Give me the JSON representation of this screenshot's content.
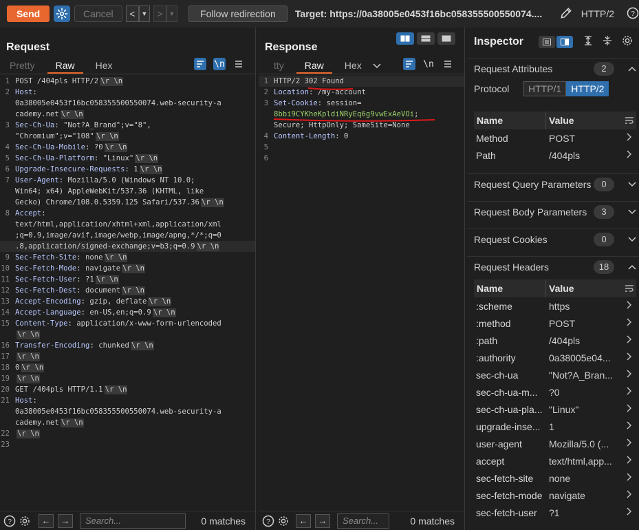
{
  "toolbar": {
    "send_label": "Send",
    "cancel_label": "Cancel",
    "back_glyph": "<",
    "forward_glyph": ">",
    "dropdown_glyph": "▼",
    "follow_label": "Follow redirection",
    "target": "Target: https://0a38005e0453f16bc058355500550074....",
    "protocol": "HTTP/2",
    "accent_color": "#e8672e",
    "settings_icon": "gear-icon",
    "edit_icon": "pencil-icon",
    "help_icon": "help-icon"
  },
  "request": {
    "title": "Request",
    "tabs": [
      "Pretty",
      "Raw",
      "Hex"
    ],
    "active_tab": "Raw",
    "icon_ln": "\\n",
    "lines": [
      {
        "n": "1",
        "parts": [
          {
            "t": "POST /404pls HTTP/2"
          }
        ],
        "eol": "\\r \\n"
      },
      {
        "n": "2",
        "parts": [
          {
            "t": "Host",
            "k": 1
          },
          {
            "t": ":"
          }
        ]
      },
      {
        "n": "",
        "parts": [
          {
            "t": "0a38005e0453f16bc058355500550074.web-security-a"
          }
        ]
      },
      {
        "n": "",
        "parts": [
          {
            "t": "cademy.net"
          }
        ],
        "eol": "\\r \\n"
      },
      {
        "n": "3",
        "parts": [
          {
            "t": "Sec-Ch-Ua",
            "k": 1
          },
          {
            "t": ": \"Not?A_Brand\";v=\"8\","
          }
        ]
      },
      {
        "n": "",
        "parts": [
          {
            "t": "\"Chromium\";v=\"108\""
          }
        ],
        "eol": "\\r \\n"
      },
      {
        "n": "4",
        "parts": [
          {
            "t": "Sec-Ch-Ua-Mobile",
            "k": 1
          },
          {
            "t": ": ?0"
          }
        ],
        "eol": "\\r \\n"
      },
      {
        "n": "5",
        "parts": [
          {
            "t": "Sec-Ch-Ua-Platform",
            "k": 1
          },
          {
            "t": ": \"Linux\""
          }
        ],
        "eol": "\\r \\n"
      },
      {
        "n": "6",
        "parts": [
          {
            "t": "Upgrade-Insecure-Requests",
            "k": 1
          },
          {
            "t": ": 1"
          }
        ],
        "eol": "\\r \\n"
      },
      {
        "n": "7",
        "parts": [
          {
            "t": "User-Agent",
            "k": 1
          },
          {
            "t": ": Mozilla/5.0 (Windows NT 10.0;"
          }
        ]
      },
      {
        "n": "",
        "parts": [
          {
            "t": "Win64; x64) AppleWebKit/537.36 (KHTML, like"
          }
        ]
      },
      {
        "n": "",
        "parts": [
          {
            "t": "Gecko) Chrome/108.0.5359.125 Safari/537.36"
          }
        ],
        "eol": "\\r \\n"
      },
      {
        "n": "8",
        "parts": [
          {
            "t": "Accept",
            "k": 1
          },
          {
            "t": ":"
          }
        ]
      },
      {
        "n": "",
        "parts": [
          {
            "t": "text/html,application/xhtml+xml,application/xml"
          }
        ]
      },
      {
        "n": "",
        "parts": [
          {
            "t": ";q=0.9,image/avif,image/webp,image/apng,*/*;q=0"
          }
        ]
      },
      {
        "n": "",
        "parts": [
          {
            "t": ".8,application/signed-exchange;v=b3;q=0.9"
          }
        ],
        "eol": "\\r \\n",
        "hl": 1
      },
      {
        "n": "9",
        "parts": [
          {
            "t": "Sec-Fetch-Site",
            "k": 1
          },
          {
            "t": ": none"
          }
        ],
        "eol": "\\r \\n"
      },
      {
        "n": "10",
        "parts": [
          {
            "t": "Sec-Fetch-Mode",
            "k": 1
          },
          {
            "t": ": navigate"
          }
        ],
        "eol": "\\r \\n"
      },
      {
        "n": "11",
        "parts": [
          {
            "t": "Sec-Fetch-User",
            "k": 1
          },
          {
            "t": ": ?1"
          }
        ],
        "eol": "\\r \\n"
      },
      {
        "n": "12",
        "parts": [
          {
            "t": "Sec-Fetch-Dest",
            "k": 1
          },
          {
            "t": ": document"
          }
        ],
        "eol": "\\r \\n"
      },
      {
        "n": "13",
        "parts": [
          {
            "t": "Accept-Encoding",
            "k": 1
          },
          {
            "t": ": gzip, deflate"
          }
        ],
        "eol": "\\r \\n"
      },
      {
        "n": "14",
        "parts": [
          {
            "t": "Accept-Language",
            "k": 1
          },
          {
            "t": ": en-US,en;q=0.9"
          }
        ],
        "eol": "\\r \\n"
      },
      {
        "n": "15",
        "parts": [
          {
            "t": "Content-Type",
            "k": 1
          },
          {
            "t": ": application/x-www-form-urlencoded"
          }
        ]
      },
      {
        "n": "",
        "parts": [],
        "eol": "\\r \\n"
      },
      {
        "n": "16",
        "parts": [
          {
            "t": "Transfer-Encoding",
            "k": 1
          },
          {
            "t": ": chunked"
          }
        ],
        "eol": "\\r \\n"
      },
      {
        "n": "17",
        "parts": [],
        "eol": "\\r \\n"
      },
      {
        "n": "18",
        "parts": [
          {
            "t": "0"
          }
        ],
        "eol": "\\r \\n"
      },
      {
        "n": "19",
        "parts": [],
        "eol": "\\r \\n"
      },
      {
        "n": "20",
        "parts": [
          {
            "t": "GET /404pls HTTP/1.1"
          }
        ],
        "eol": "\\r \\n"
      },
      {
        "n": "21",
        "parts": [
          {
            "t": "Host",
            "k": 1
          },
          {
            "t": ":"
          }
        ]
      },
      {
        "n": "",
        "parts": [
          {
            "t": "0a38005e0453f16bc058355500550074.web-security-a"
          }
        ]
      },
      {
        "n": "",
        "parts": [
          {
            "t": "cademy.net"
          }
        ],
        "eol": "\\r \\n"
      },
      {
        "n": "22",
        "parts": [],
        "eol": "\\r \\n"
      },
      {
        "n": "23",
        "parts": []
      }
    ],
    "search_placeholder": "Search...",
    "matches": "0 matches"
  },
  "response": {
    "title": "Response",
    "tabs": [
      "tty",
      "Raw",
      "Hex"
    ],
    "active_tab": "Raw",
    "icon_ln": "\\n",
    "lines": [
      {
        "n": "1",
        "parts": [
          {
            "t": "HTTP/2 302 Found"
          }
        ],
        "hl": 1
      },
      {
        "n": "2",
        "parts": [
          {
            "t": "Location",
            "k": 1
          },
          {
            "t": ": /my-account"
          }
        ]
      },
      {
        "n": "3",
        "parts": [
          {
            "t": "Set-Cookie",
            "k": 1
          },
          {
            "t": ": session="
          }
        ]
      },
      {
        "n": "",
        "parts": [
          {
            "t": "8bbi9CYKheKpldiNRyEq6g9vwExAeVOi",
            "c": 1
          },
          {
            "t": ";"
          }
        ]
      },
      {
        "n": "",
        "parts": [
          {
            "t": "Secure; HttpOnly; SameSite=None"
          }
        ]
      },
      {
        "n": "4",
        "parts": [
          {
            "t": "Content-Length",
            "k": 1
          },
          {
            "t": ": 0"
          }
        ]
      },
      {
        "n": "5",
        "parts": []
      },
      {
        "n": "6",
        "parts": []
      }
    ],
    "search_placeholder": "Search...",
    "matches": "0 matches"
  },
  "inspector": {
    "title": "Inspector",
    "request_attributes": {
      "label": "Request Attributes",
      "count": "2"
    },
    "protocol_label": "Protocol",
    "protocol_options": [
      "HTTP/1",
      "HTTP/2"
    ],
    "protocol_selected": "HTTP/2",
    "attr_columns": [
      "Name",
      "Value"
    ],
    "attr_rows": [
      {
        "name": "Method",
        "value": "POST"
      },
      {
        "name": "Path",
        "value": "/404pls"
      }
    ],
    "query_params": {
      "label": "Request Query Parameters",
      "count": "0"
    },
    "body_params": {
      "label": "Request Body Parameters",
      "count": "3"
    },
    "cookies": {
      "label": "Request Cookies",
      "count": "0"
    },
    "headers": {
      "label": "Request Headers",
      "count": "18"
    },
    "header_columns": [
      "Name",
      "Value"
    ],
    "header_rows": [
      {
        "name": ":scheme",
        "value": "https"
      },
      {
        "name": ":method",
        "value": "POST"
      },
      {
        "name": ":path",
        "value": "/404pls"
      },
      {
        "name": ":authority",
        "value": "0a38005e04..."
      },
      {
        "name": "sec-ch-ua",
        "value": "\"Not?A_Bran..."
      },
      {
        "name": "sec-ch-ua-m...",
        "value": "?0"
      },
      {
        "name": "sec-ch-ua-pla...",
        "value": "\"Linux\""
      },
      {
        "name": "upgrade-inse...",
        "value": "1"
      },
      {
        "name": "user-agent",
        "value": "Mozilla/5.0 (..."
      },
      {
        "name": "accept",
        "value": "text/html,app..."
      },
      {
        "name": "sec-fetch-site",
        "value": "none"
      },
      {
        "name": "sec-fetch-mode",
        "value": "navigate"
      },
      {
        "name": "sec-fetch-user",
        "value": "?1"
      }
    ]
  }
}
